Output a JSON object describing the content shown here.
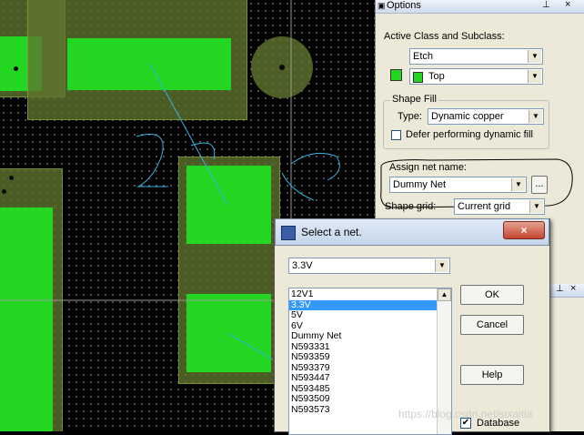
{
  "options_panel": {
    "title": "Options",
    "active_class_label": "Active Class and Subclass:",
    "class_value": "Etch",
    "subclass_value": "Top",
    "subclass_color": "#22d622",
    "shape_fill_label": "Shape Fill",
    "type_label": "Type:",
    "type_value": "Dynamic copper",
    "defer_label": "Defer performing dynamic fill",
    "assign_net_label": "Assign net name:",
    "net_value": "Dummy Net",
    "browse_label": "...",
    "shape_grid_label": "Shape grid:",
    "shape_grid_value": "Current grid"
  },
  "dialog": {
    "title": "Select a net.",
    "selected_value": "3.3V",
    "items": [
      "12V1",
      "3.3V",
      "5V",
      "6V",
      "Dummy Net",
      "N593331",
      "N593359",
      "N593379",
      "N593447",
      "N593485",
      "N593509",
      "N593573"
    ],
    "selected_index": 1,
    "ok_label": "OK",
    "cancel_label": "Cancel",
    "help_label": "Help",
    "database_label": "Database",
    "database_checked": true
  },
  "board": {
    "pad_color": "#22d622",
    "ratsnest_color": "#35b5e5"
  },
  "watermark": "https://blog.csdn.net/sixaitia"
}
